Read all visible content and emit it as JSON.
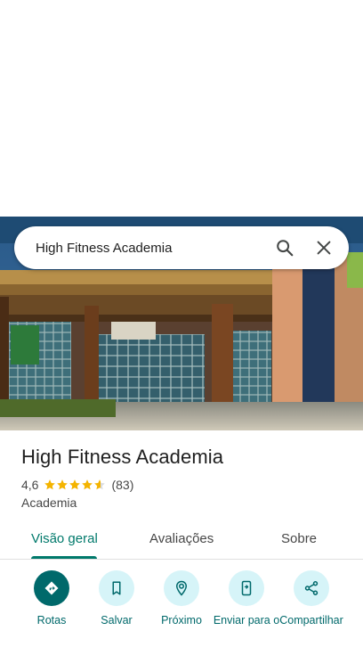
{
  "search": {
    "query": "High Fitness Academia",
    "search_icon": "search-icon",
    "close_icon": "close-icon"
  },
  "place": {
    "title": "High Fitness Academia",
    "rating": "4,6",
    "rating_value": 4.6,
    "review_count": "(83)",
    "category": "Academia"
  },
  "tabs": [
    {
      "label": "Visão geral",
      "active": true
    },
    {
      "label": "Avaliações",
      "active": false
    },
    {
      "label": "Sobre",
      "active": false
    }
  ],
  "actions": [
    {
      "label": "Rotas",
      "icon": "directions-icon"
    },
    {
      "label": "Salvar",
      "icon": "bookmark-icon"
    },
    {
      "label": "Próximo",
      "icon": "nearby-icon"
    },
    {
      "label": "Enviar para o",
      "icon": "send-to-phone-icon"
    },
    {
      "label": "Compartilhar",
      "icon": "share-icon"
    }
  ],
  "colors": {
    "accent": "#00796b",
    "action_primary": "#00696b",
    "action_bg": "#d6f4f8",
    "star": "#f4b400"
  }
}
